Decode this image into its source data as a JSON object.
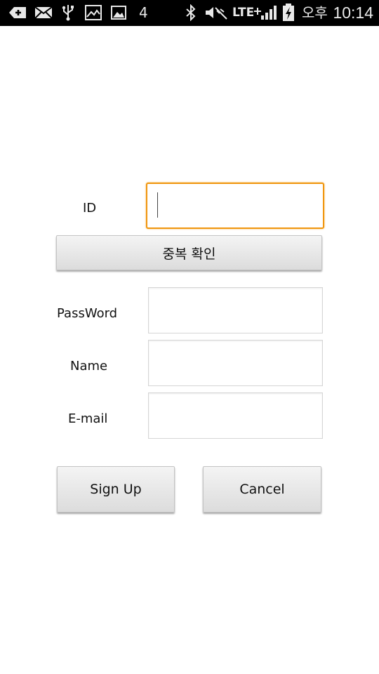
{
  "status_bar": {
    "icons": [
      "add-icon",
      "mail-icon",
      "usb-icon",
      "gallery-icon",
      "image-icon",
      "bluetooth-icon",
      "mute-icon",
      "network-type-icon",
      "signal-icon",
      "battery-charging-icon"
    ],
    "notification_count": "4",
    "network_label": "LTE",
    "ampm": "오후",
    "time": "10:14"
  },
  "form": {
    "id_label": "ID",
    "id_value": "",
    "check_duplicate_label": "중복 확인",
    "password_label": "PassWord",
    "password_value": "",
    "name_label": "Name",
    "name_value": "",
    "email_label": "E-mail",
    "email_value": ""
  },
  "actions": {
    "sign_up_label": "Sign Up",
    "cancel_label": "Cancel"
  },
  "colors": {
    "focus_border": "#f0960f",
    "status_bar_bg": "#000000",
    "page_bg": "#ffffff"
  }
}
